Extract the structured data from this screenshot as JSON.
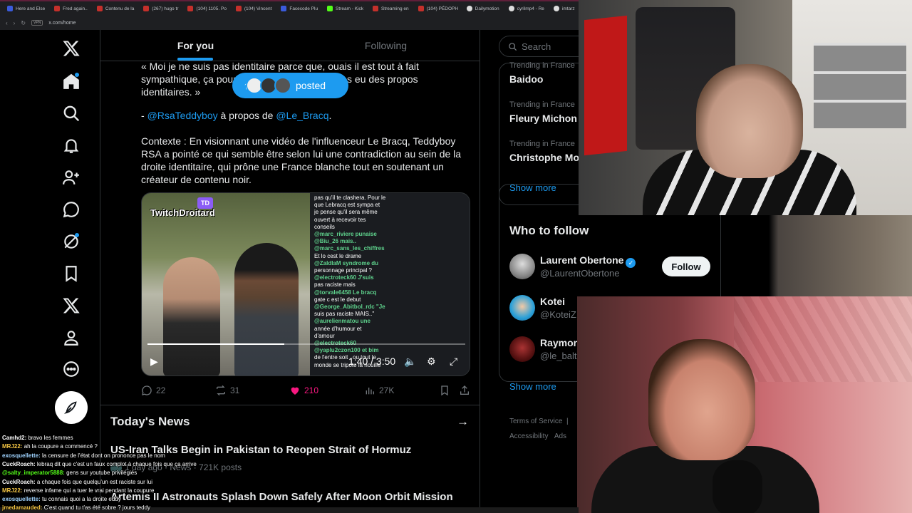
{
  "browser": {
    "tabs": [
      "Here and Else",
      "Fred again..",
      "Contenu de la",
      "(267) hugo tr",
      "(104) 1105. Po",
      "(104) Vincent",
      "Facecode Plu",
      "Stream - Kick",
      "Streaming en",
      "(104) PÉDOPH",
      "Dailymotion",
      "cyrilmp4 - Re",
      "imtarz"
    ],
    "url": "x.com/home",
    "url_badge": "VPN"
  },
  "feed_tabs": {
    "for_you": "For you",
    "following": "Following"
  },
  "tweet": {
    "line1": "« Moi je ne suis pas identitaire parce que, ouais il est tout à fait",
    "line2": "sympathique, ça pourrait ... mais je n'aurais pas eu des propos",
    "line3": "identitaires. »",
    "attr_prefix": "- ",
    "attr_user": "@RsaTeddyboy",
    "attr_mid": " à propos de ",
    "attr_target": "@Le_Bracq",
    "attr_suffix": ".",
    "context": "Contexte : En visionnant une vidéo de l'influenceur Le Bracq, Teddyboy RSA a pointé ce qui semble être selon lui une contradiction au sein de la droite identitaire, qui prône une France blanche tout en soutenant un créateur de contenu noir.",
    "posted_label": "posted",
    "video": {
      "logo_badge": "TD",
      "logo_text": "TwitchDroitard",
      "time": "1:40 / 3:50",
      "progress": 0.43,
      "chat": [
        {
          "t": "pas qu'il te clashera. Pour le",
          "c": "#ffffff"
        },
        {
          "t": "que Lebracq est sympa et",
          "c": "#ffffff"
        },
        {
          "t": "je pense qu'il sera même",
          "c": "#ffffff"
        },
        {
          "t": "ouvert à recevoir tes",
          "c": "#ffffff"
        },
        {
          "t": "conseils",
          "c": "#ffffff"
        },
        {
          "t": "@marc_riviere punaise",
          "c": "#5fd38d"
        },
        {
          "t": "@Biu_26 mais..",
          "c": "#5fd38d"
        },
        {
          "t": "@marc_sans_les_chiffres",
          "c": "#5fd38d"
        },
        {
          "t": "Et lo cest le drame",
          "c": "#ffffff"
        },
        {
          "t": "@ZaldIaM syndrome du",
          "c": "#5fd38d"
        },
        {
          "t": "personnage principal ?",
          "c": "#ffffff"
        },
        {
          "t": "@electroteck60 J'suis",
          "c": "#5fd38d"
        },
        {
          "t": "pas raciste mais",
          "c": "#ffffff"
        },
        {
          "t": "@torvale6458 Le bracq",
          "c": "#5fd38d"
        },
        {
          "t": "gate c est le debut",
          "c": "#ffffff"
        },
        {
          "t": "@George_Abitbol_rdc \"Je",
          "c": "#5fd38d"
        },
        {
          "t": "suis pas raciste MAIS..\"",
          "c": "#ffffff"
        },
        {
          "t": "@aurelienmatou une",
          "c": "#5fd38d"
        },
        {
          "t": "année d'humour et",
          "c": "#ffffff"
        },
        {
          "t": "d'amour",
          "c": "#ffffff"
        },
        {
          "t": "@electroteck60",
          "c": "#5fd38d"
        },
        {
          "t": "@yaplu2czon100 et bim",
          "c": "#5fd38d"
        },
        {
          "t": "de l'entre soit , ou tout le",
          "c": "#ffffff"
        },
        {
          "t": "monde se tripote la nouille",
          "c": "#ffffff"
        }
      ]
    },
    "actions": {
      "replies": "22",
      "reposts": "31",
      "likes": "210",
      "views": "27K"
    }
  },
  "news": {
    "title": "Today's News",
    "items": [
      {
        "headline": "US-Iran Talks Begin in Pakistan to Reopen Strait of Hormuz",
        "meta": "1 day ago · News · 721K posts"
      },
      {
        "headline": "Artemis II Astronauts Splash Down Safely After Moon Orbit Mission",
        "meta": ""
      }
    ]
  },
  "right": {
    "search_placeholder": "Search",
    "trends": [
      {
        "label": "Trending in France",
        "name": "Baidoo"
      },
      {
        "label": "Trending in France",
        "name": "Fleury Michon"
      },
      {
        "label": "Trending in France",
        "name": "Christophe Mor"
      }
    ],
    "show_more": "Show more",
    "who_to_follow": "Who to follow",
    "follow_label": "Follow",
    "people": [
      {
        "name": "Laurent Obertone",
        "handle": "@LaurentObertone",
        "verified": true
      },
      {
        "name": "Kotei",
        "handle": "@KoteiZ",
        "verified": false
      },
      {
        "name": "Raymon",
        "handle": "@le_balt",
        "verified": false
      }
    ],
    "footer": [
      "Terms of Service",
      "|",
      "Accessibility",
      "Ads"
    ]
  },
  "stream_chat": [
    {
      "user": "Camhd2",
      "uc": "#ffffff",
      "msg": "bravo les femmes"
    },
    {
      "user": "MRJ22",
      "uc": "#f6c744",
      "msg": "ah la coupure a commencé ?"
    },
    {
      "user": "exosquellette",
      "uc": "#9fd3ff",
      "msg": "la censure de l'état dont on prononce pas le nom"
    },
    {
      "user": "CuckRoach",
      "uc": "#ffffff",
      "msg": "lebraq dit que c'est un faux complot à chaque fois que ça arrive"
    },
    {
      "user": "@salty_imperator5888",
      "uc": "#53fc18",
      "msg": "gens sur youtube privilégiés"
    },
    {
      "user": "CuckRoach",
      "uc": "#ffffff",
      "msg": "a chaque fois que quelqu'un est raciste sur lui"
    },
    {
      "user": "MRJ22",
      "uc": "#f6c744",
      "msg": "reverse infame qui a tuer le vrai pendant la coupure"
    },
    {
      "user": "exosquellette",
      "uc": "#9fd3ff",
      "msg": "tu connais quoi a la droite eddy"
    },
    {
      "user": "jmedamauded",
      "uc": "#f6c744",
      "msg": "C'est quand tu t'as été sobre ? jours teddy"
    }
  ]
}
